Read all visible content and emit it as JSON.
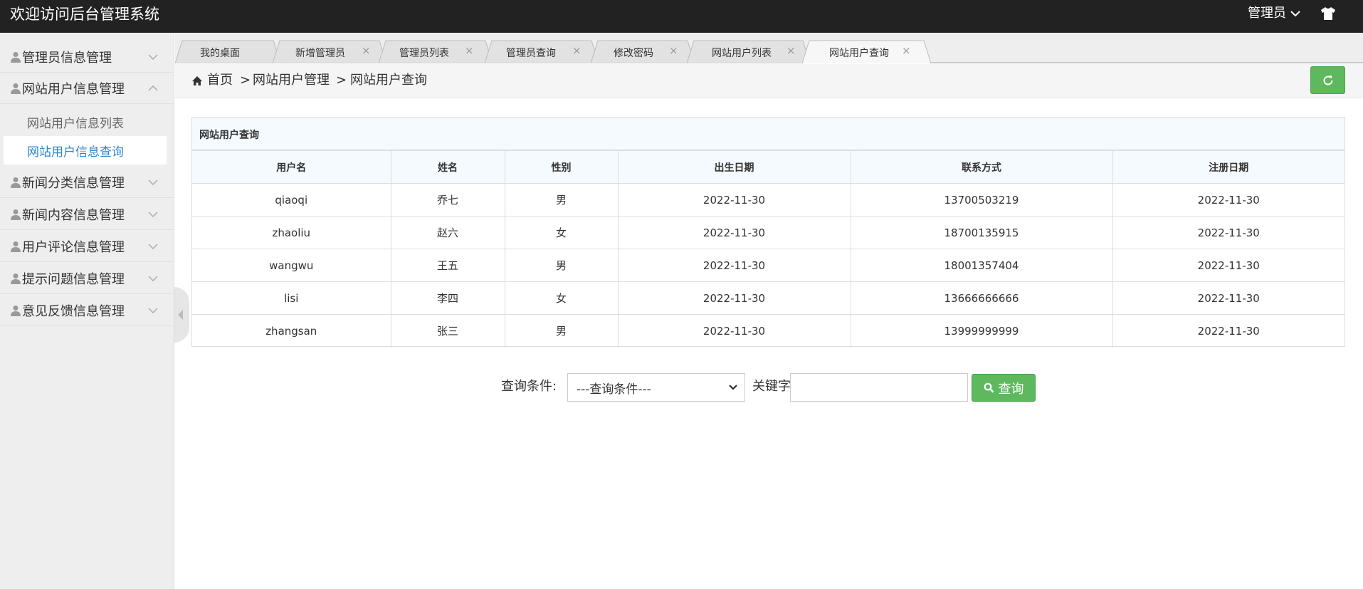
{
  "header": {
    "title": "欢迎访问后台管理系统",
    "user_label": "管理员"
  },
  "sidebar": {
    "items": [
      {
        "label": "管理员信息管理"
      },
      {
        "label": "网站用户信息管理",
        "expanded": true,
        "children": [
          {
            "label": "网站用户信息列表"
          },
          {
            "label": "网站用户信息查询",
            "active": true
          }
        ]
      },
      {
        "label": "新闻分类信息管理"
      },
      {
        "label": "新闻内容信息管理"
      },
      {
        "label": "用户评论信息管理"
      },
      {
        "label": "提示问题信息管理"
      },
      {
        "label": "意见反馈信息管理"
      }
    ]
  },
  "tabs": [
    {
      "label": "我的桌面"
    },
    {
      "label": "新增管理员"
    },
    {
      "label": "管理员列表"
    },
    {
      "label": "管理员查询"
    },
    {
      "label": "修改密码"
    },
    {
      "label": "网站用户列表"
    },
    {
      "label": "网站用户查询",
      "active": true
    }
  ],
  "tab_close_glyph": "×",
  "breadcrumb": {
    "items": [
      "首页",
      "网站用户管理",
      "网站用户查询"
    ],
    "separator": ">"
  },
  "table": {
    "title": "网站用户查询",
    "columns": [
      "用户名",
      "姓名",
      "性别",
      "出生日期",
      "联系方式",
      "注册日期"
    ],
    "rows": [
      [
        "qiaoqi",
        "乔七",
        "男",
        "2022-11-30",
        "13700503219",
        "2022-11-30"
      ],
      [
        "zhaoliu",
        "赵六",
        "女",
        "2022-11-30",
        "18700135915",
        "2022-11-30"
      ],
      [
        "wangwu",
        "王五",
        "男",
        "2022-11-30",
        "18001357404",
        "2022-11-30"
      ],
      [
        "lisi",
        "李四",
        "女",
        "2022-11-30",
        "13666666666",
        "2022-11-30"
      ],
      [
        "zhangsan",
        "张三",
        "男",
        "2022-11-30",
        "13999999999",
        "2022-11-30"
      ]
    ]
  },
  "query": {
    "condition_label": "查询条件:",
    "condition_selected": "---查询条件---",
    "keyword_label": "关键字",
    "keyword_value": "",
    "button_label": "查询"
  },
  "colors": {
    "header_bg": "#222222",
    "accent_green": "#5eb95e",
    "active_link": "#2f85c9"
  },
  "icons": [
    "user-icon",
    "chevron-down-icon",
    "chevron-up-icon",
    "shirt-icon",
    "home-icon",
    "refresh-icon",
    "search-icon",
    "close-icon"
  ]
}
